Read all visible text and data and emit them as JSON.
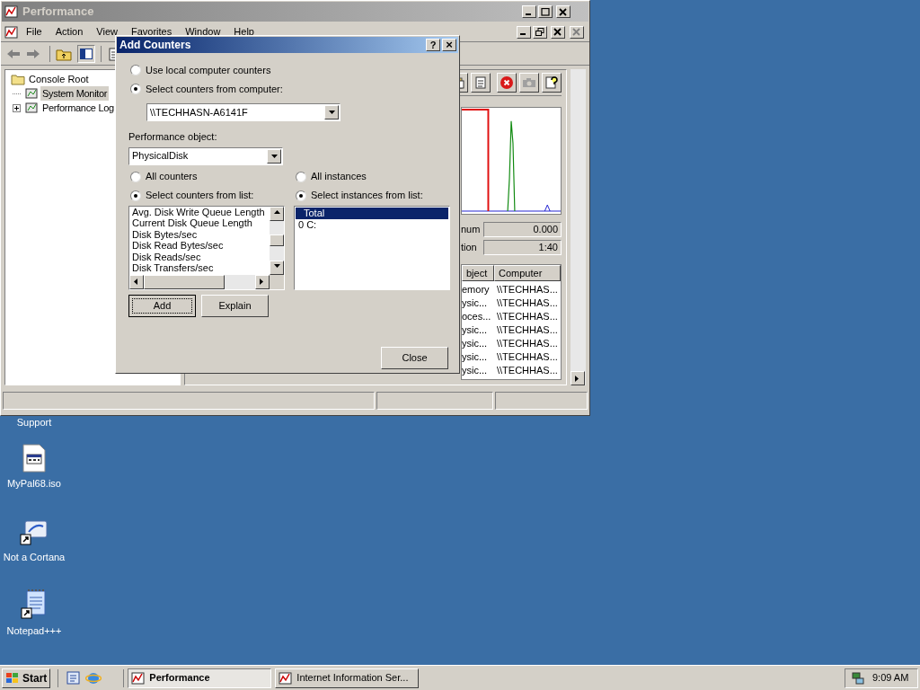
{
  "main_window": {
    "title": "Performance",
    "menu": [
      "File",
      "Action",
      "View",
      "Favorites",
      "Window",
      "Help"
    ],
    "tree": [
      {
        "label": "Console Root",
        "children": [
          {
            "label": "System Monitor",
            "selected": true,
            "expandable": false
          },
          {
            "label": "Performance Log",
            "selected": false,
            "expandable": true
          }
        ]
      }
    ],
    "readings": [
      {
        "label": "num",
        "value": "0.000"
      },
      {
        "label": "tion",
        "value": "1:40"
      }
    ],
    "table": {
      "columns": [
        "bject",
        "Computer"
      ],
      "rows": [
        [
          "emory",
          "\\\\TECHHAS..."
        ],
        [
          "ysic...",
          "\\\\TECHHAS..."
        ],
        [
          "oces...",
          "\\\\TECHHAS..."
        ],
        [
          "ysic...",
          "\\\\TECHHAS..."
        ],
        [
          "ysic...",
          "\\\\TECHHAS..."
        ],
        [
          "ysic...",
          "\\\\TECHHAS..."
        ],
        [
          "ysic...",
          "\\\\TECHHAS..."
        ]
      ]
    }
  },
  "dialog": {
    "title": "Add Counters",
    "help_button": "?",
    "close_button": "×",
    "source_options": [
      {
        "label": "Use local computer counters",
        "selected": false
      },
      {
        "label": "Select counters from computer:",
        "selected": true
      }
    ],
    "computer": "\\\\TECHHASN-A6141F",
    "object_label": "Performance object:",
    "object": "PhysicalDisk",
    "counter_options": [
      {
        "label": "All counters",
        "selected": false
      },
      {
        "label": "Select counters from list:",
        "selected": true
      }
    ],
    "instance_options": [
      {
        "label": "All instances",
        "selected": false
      },
      {
        "label": "Select instances from list:",
        "selected": true
      }
    ],
    "counters": [
      "Avg. Disk Write Queue Length",
      "Current Disk Queue Length",
      "Disk Bytes/sec",
      "Disk Read Bytes/sec",
      "Disk Reads/sec",
      "Disk Transfers/sec"
    ],
    "instances": [
      {
        "label": "Total",
        "selected": true
      },
      {
        "label": "0 C:",
        "selected": false
      }
    ],
    "buttons": [
      {
        "label": "Add",
        "focused": true
      },
      {
        "label": "Explain",
        "focused": false
      }
    ],
    "close": "Close"
  },
  "desktop_icons": [
    {
      "label": "Support",
      "kind": "hidden"
    },
    {
      "label": "MyPal68.iso",
      "kind": "file"
    },
    {
      "label": "Not a Cortana",
      "kind": "shortcut"
    },
    {
      "label": "Notepad+++",
      "kind": "notepad"
    }
  ],
  "taskbar": {
    "start": "Start",
    "tasks": [
      {
        "label": "Performance",
        "selected": true
      },
      {
        "label": "Internet Information Ser...",
        "selected": false
      }
    ],
    "clock": "9:09 AM"
  }
}
